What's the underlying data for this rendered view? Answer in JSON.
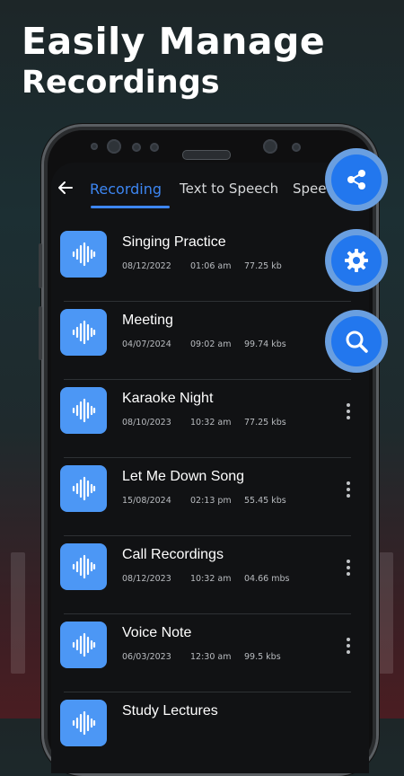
{
  "headline": {
    "line1": "Easily Manage",
    "line2": "Recordings"
  },
  "tabs": [
    {
      "label": "Recording",
      "active": true
    },
    {
      "label": "Text to Speech",
      "active": false
    },
    {
      "label": "Speech",
      "active": false
    }
  ],
  "recordings": [
    {
      "title": "Singing Practice",
      "date": "08/12/2022",
      "time": "01:06 am",
      "size": "77.25 kb"
    },
    {
      "title": "Meeting",
      "date": "04/07/2024",
      "time": "09:02 am",
      "size": "99.74 kbs"
    },
    {
      "title": "Karaoke Night",
      "date": "08/10/2023",
      "time": "10:32 am",
      "size": "77.25 kbs"
    },
    {
      "title": "Let Me Down Song",
      "date": "15/08/2024",
      "time": "02:13 pm",
      "size": "55.45 kbs"
    },
    {
      "title": "Call Recordings",
      "date": "08/12/2023",
      "time": "10:32 am",
      "size": "04.66 mbs"
    },
    {
      "title": "Voice Note",
      "date": "06/03/2023",
      "time": "12:30 am",
      "size": "99.5 kbs"
    },
    {
      "title": "Study Lectures",
      "date": "",
      "time": "",
      "size": ""
    }
  ],
  "fabs": [
    "share-icon",
    "gear-icon",
    "search-icon"
  ],
  "colors": {
    "accent": "#2277ee",
    "tab_active": "#3d86f2",
    "icon_tile": "#4c97f5"
  }
}
